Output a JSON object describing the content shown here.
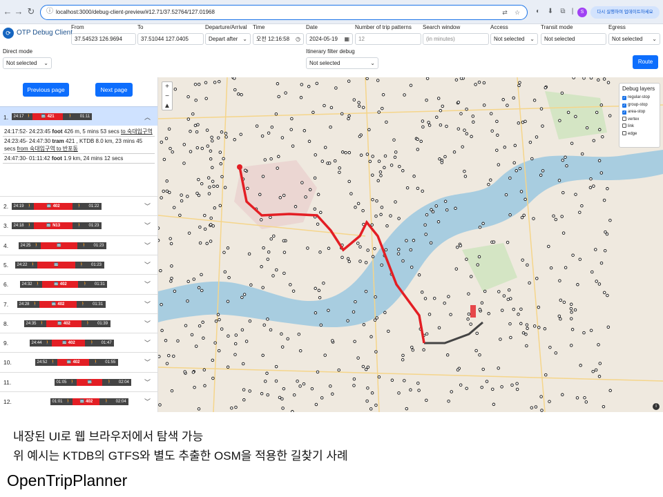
{
  "browser": {
    "url": "localhost:3000/debug-client-preview/#12.71/37.52764/127.01968",
    "update_label": "다시 실행하여 업데이트하세요"
  },
  "app": {
    "title": "OTP Debug Client",
    "route_label": "Route",
    "form": {
      "from_label": "From",
      "from_value": "37.54523 126.9694",
      "to_label": "To",
      "to_value": "37.51044 127.0405",
      "dep_label": "Departure/Arrival",
      "dep_value": "Depart after",
      "time_label": "Time",
      "time_value": "오전 12:16:58",
      "date_label": "Date",
      "date_value": "2024-05-19",
      "ntp_label": "Number of trip patterns",
      "ntp_placeholder": "12",
      "sw_label": "Search window",
      "sw_placeholder": "(in minutes)",
      "access_label": "Access",
      "access_value": "Not selected",
      "transit_label": "Transit mode",
      "transit_value": "Not selected",
      "egress_label": "Egress",
      "egress_value": "Not selected",
      "direct_label": "Direct mode",
      "direct_value": "Not selected",
      "ifd_label": "Itinerary filter debug",
      "ifd_value": "Not selected"
    }
  },
  "sidebar": {
    "prev_label": "Previous page",
    "next_label": "Next page",
    "first": {
      "num": "1.",
      "start": "24:17",
      "route": "421",
      "end": "01:11",
      "legs": [
        {
          "time": "24:17:52- 24:23:45",
          "mode": "foot",
          "rest": " 426 m, 5 mins 53 secs ",
          "to": "to 숙대입구역"
        },
        {
          "time": "24:23:45- 24:47:30",
          "mode": "tram",
          "rest": " 421 , KTDB 8.0 km, 23 mins 45 secs ",
          "to": "from 숙대입구역 to 반포동"
        },
        {
          "time": "24:47:30- 01:11:42",
          "mode": "foot",
          "rest": " 1.9 km, 24 mins 12 secs",
          "to": ""
        }
      ]
    },
    "items": [
      {
        "num": "2.",
        "start": "24:19",
        "route": "402",
        "end": "01:22"
      },
      {
        "num": "3.",
        "start": "24:18",
        "route": "N13",
        "end": "01:23"
      },
      {
        "num": "4.",
        "start": "24:25",
        "route": "",
        "end": "01:23"
      },
      {
        "num": "5.",
        "start": "24:22",
        "route": "",
        "end": "01:23"
      },
      {
        "num": "6.",
        "start": "24:32",
        "route": "402",
        "end": "01:31"
      },
      {
        "num": "7.",
        "start": "24:28",
        "route": "402",
        "end": "01:31"
      },
      {
        "num": "8.",
        "start": "24:35",
        "route": "402",
        "end": "01:39"
      },
      {
        "num": "9.",
        "start": "24:44",
        "route": "402",
        "end": "01:47"
      },
      {
        "num": "10.",
        "start": "24:52",
        "route": "402",
        "end": "01:55"
      },
      {
        "num": "11.",
        "start": "01:05",
        "route": "",
        "end": "02:04"
      },
      {
        "num": "12.",
        "start": "01:01",
        "route": "402",
        "end": "02:04"
      }
    ]
  },
  "map": {
    "layers_title": "Debug layers",
    "layers": [
      {
        "label": "regular-stop",
        "checked": true
      },
      {
        "label": "group-stop",
        "checked": true
      },
      {
        "label": "area-stop",
        "checked": true
      },
      {
        "label": "vertex",
        "checked": false
      },
      {
        "label": "link",
        "checked": false
      },
      {
        "label": "edge",
        "checked": false
      }
    ],
    "route_color": "#e31e24",
    "walk_color": "#444444",
    "river_color": "#a8cde0"
  },
  "caption": {
    "line1": "내장된 UI로 웹 브라우저에서 탐색 가능",
    "line2": "위 예시는 KTDB의 GTFS와 별도 추출한 OSM을 적용한 길찾기 사례",
    "title": "OpenTripPlanner"
  }
}
